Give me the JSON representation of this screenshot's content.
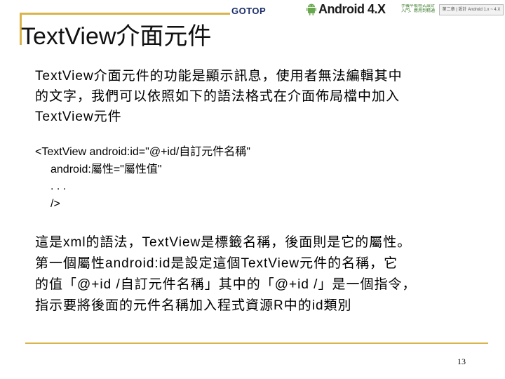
{
  "header": {
    "publisher_logo": "GOTOP",
    "book_logo": "Android 4.X",
    "book_subtitle": "手機平板程式設計入門、應用到精通",
    "chapter_label": "第二章 | 設計 Android 1.x ~ 4.X"
  },
  "slide": {
    "title": "TextView介面元件",
    "paragraph1": [
      "TextView介面元件的功能是顯示訊息，使用者無法編輯其中",
      "的文字，我們可以依照如下的語法格式在介面佈局檔中加入",
      "TextView元件"
    ],
    "code": [
      "<TextView android:id=\"@+id/自訂元件名稱\"",
      "android:屬性=\"屬性值\"",
      ". . .",
      "/>"
    ],
    "paragraph2": [
      "這是xml的語法，TextView是標籤名稱，後面則是它的屬性。",
      "第一個屬性android:id是設定這個TextView元件的名稱，它",
      "的值「@+id /自訂元件名稱」其中的「@+id /」是一個指令，",
      "指示要將後面的元件名稱加入程式資源R中的id類別"
    ],
    "page_number": "13"
  },
  "colors": {
    "accent_gold": "#d9b44a",
    "gotop_blue": "#1b2e6b",
    "book_green": "#3a7a2a"
  }
}
